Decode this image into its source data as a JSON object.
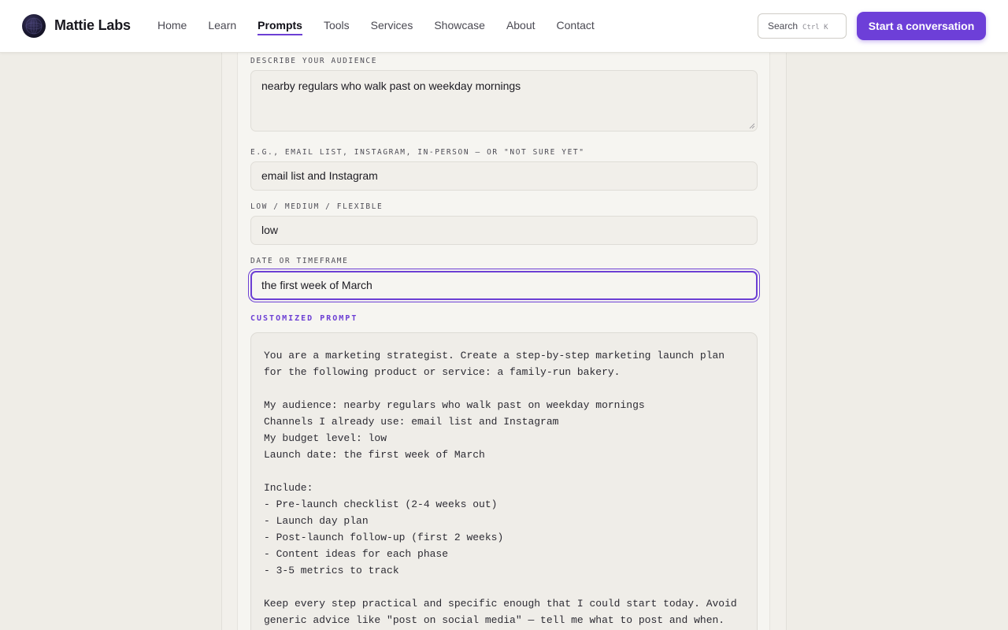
{
  "header": {
    "brand": "Mattie Labs",
    "logo_icon": "logo-mark-icon",
    "nav": [
      {
        "label": "Home",
        "active": false
      },
      {
        "label": "Learn",
        "active": false
      },
      {
        "label": "Prompts",
        "active": true
      },
      {
        "label": "Tools",
        "active": false
      },
      {
        "label": "Services",
        "active": false
      },
      {
        "label": "Showcase",
        "active": false
      },
      {
        "label": "About",
        "active": false
      },
      {
        "label": "Contact",
        "active": false
      }
    ],
    "search_label": "Search",
    "search_shortcut": "Ctrl K",
    "cta_label": "Start a conversation",
    "accent_color": "#6d3fd8"
  },
  "form": {
    "audience": {
      "label": "Describe your audience",
      "value": "nearby regulars who walk past on weekday mornings"
    },
    "channels": {
      "label": "e.g., email list, Instagram, in-person — or \"not sure yet\"",
      "value": "email list and Instagram"
    },
    "budget": {
      "label": "Low / Medium / Flexible",
      "value": "low"
    },
    "launch_date": {
      "label": "Date or timeframe",
      "value": "the first week of March"
    }
  },
  "output": {
    "title": "CUSTOMIZED PROMPT",
    "text": "You are a marketing strategist. Create a step-by-step marketing launch plan\nfor the following product or service: a family-run bakery.\n\nMy audience: nearby regulars who walk past on weekday mornings\nChannels I already use: email list and Instagram\nMy budget level: low\nLaunch date: the first week of March\n\nInclude:\n- Pre-launch checklist (2-4 weeks out)\n- Launch day plan\n- Post-launch follow-up (first 2 weeks)\n- Content ideas for each phase\n- 3-5 metrics to track\n\nKeep every step practical and specific enough that I could start today. Avoid\ngeneric advice like \"post on social media\" — tell me what to post and when."
  }
}
